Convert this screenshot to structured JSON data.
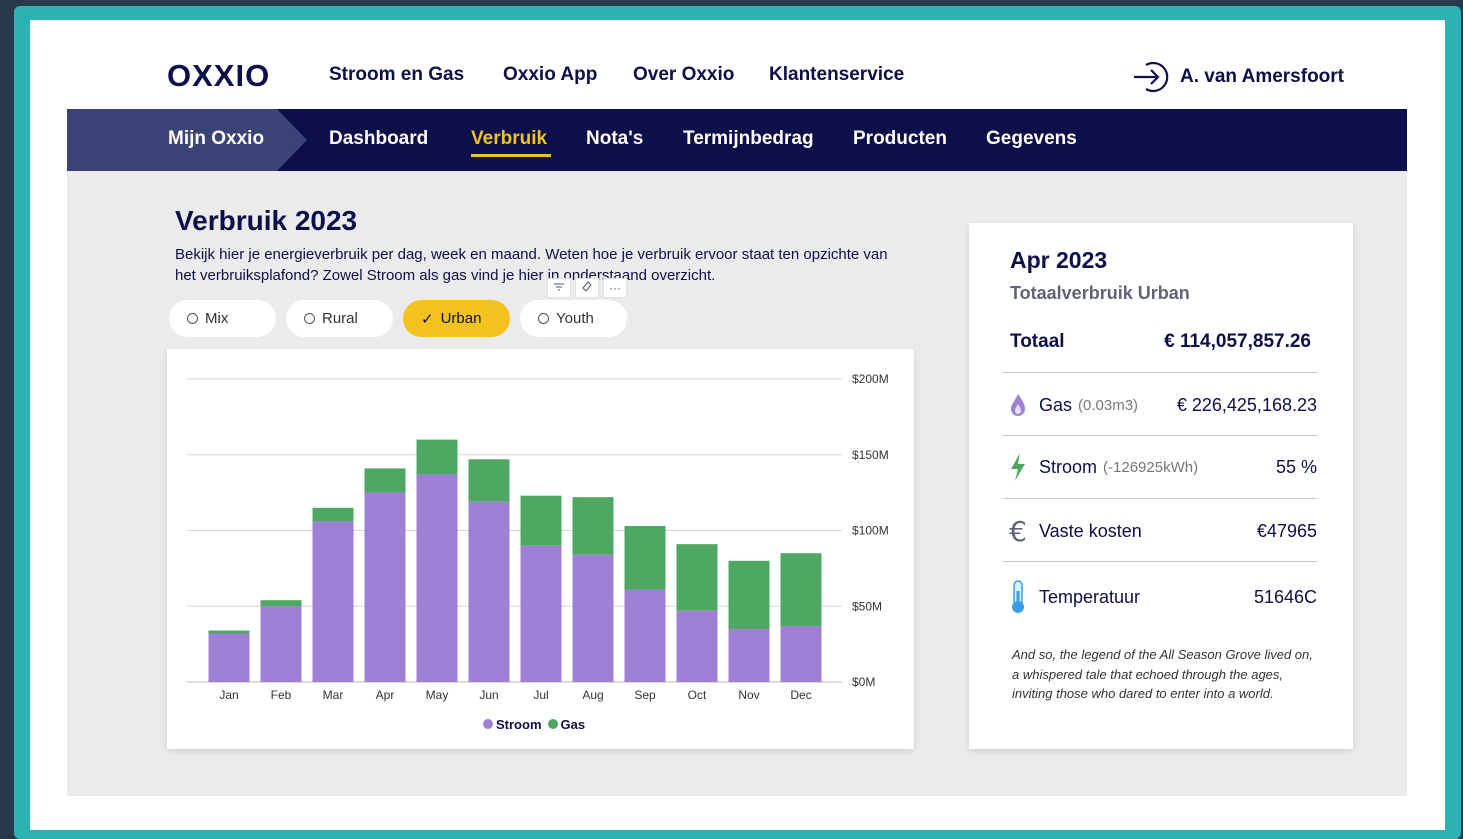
{
  "brand": {
    "logo": "OXXIO"
  },
  "topnav": [
    "Stroom en Gas",
    "Oxxio App",
    "Over Oxxio",
    "Klantenservice"
  ],
  "user": {
    "name": "A. van Amersfoort",
    "icon": "login-arrow-icon"
  },
  "subnav": {
    "home": "Mijn Oxxio",
    "items": [
      "Dashboard",
      "Verbruik",
      "Nota's",
      "Termijnbedrag",
      "Producten",
      "Gegevens"
    ],
    "active": "Verbruik"
  },
  "page": {
    "title": "Verbruik 2023",
    "description": "Bekijk hier je energieverbruik per dag, week en maand. Weten hoe je verbruik ervoor staat ten opzichte van het verbruiksplafond? Zowel Stroom als gas vind je hier in onderstaand overzicht.",
    "toolbar_icons": [
      "filter-icon",
      "eraser-icon",
      "more-icon"
    ],
    "toolbar_more": "···"
  },
  "segments": [
    {
      "label": "Mix",
      "selected": false
    },
    {
      "label": "Rural",
      "selected": false
    },
    {
      "label": "Urban",
      "selected": true
    },
    {
      "label": "Youth",
      "selected": false
    }
  ],
  "colors": {
    "navy": "#0c0f4a",
    "accent": "#f4c21e",
    "stroom": "#9e80d5",
    "gas": "#4ea863",
    "frame": "#2bb3b4"
  },
  "chart_data": {
    "type": "bar",
    "stacked": true,
    "categories": [
      "Jan",
      "Feb",
      "Mar",
      "Apr",
      "May",
      "Jun",
      "Jul",
      "Aug",
      "Sep",
      "Oct",
      "Nov",
      "Dec"
    ],
    "series": [
      {
        "name": "Stroom",
        "values": [
          32,
          50,
          106,
          125,
          137,
          119,
          90,
          84,
          61,
          47,
          35,
          37
        ]
      },
      {
        "name": "Gas",
        "values": [
          2,
          4,
          9,
          16,
          23,
          28,
          33,
          38,
          42,
          44,
          45,
          48
        ]
      }
    ],
    "yticks": [
      "$0M",
      "$50M",
      "$100M",
      "$150M",
      "$200M"
    ],
    "ylim": [
      0,
      200
    ],
    "grid": true,
    "legend": "bottom-center"
  },
  "summary": {
    "month": "Apr 2023",
    "subtitle": "Totaalverbruik Urban",
    "total_label": "Totaal",
    "total_value": "€ 114,057,857.26",
    "rows": [
      {
        "icon": "flame-icon",
        "label": "Gas",
        "note": "(0.03m3)",
        "value": "€ 226,425,168.23"
      },
      {
        "icon": "lightning-icon",
        "label": "Stroom",
        "note": "(-126925kWh)",
        "value": "55 %"
      },
      {
        "icon": "euro-icon",
        "label": "Vaste kosten",
        "note": "",
        "value": "€47965"
      },
      {
        "icon": "thermometer-icon",
        "label": "Temperatuur",
        "note": "",
        "value": "51646C"
      }
    ],
    "story": "And so, the legend of the All Season Grove lived on, a whispered tale that echoed through the ages, inviting those who dared to enter into a world."
  }
}
